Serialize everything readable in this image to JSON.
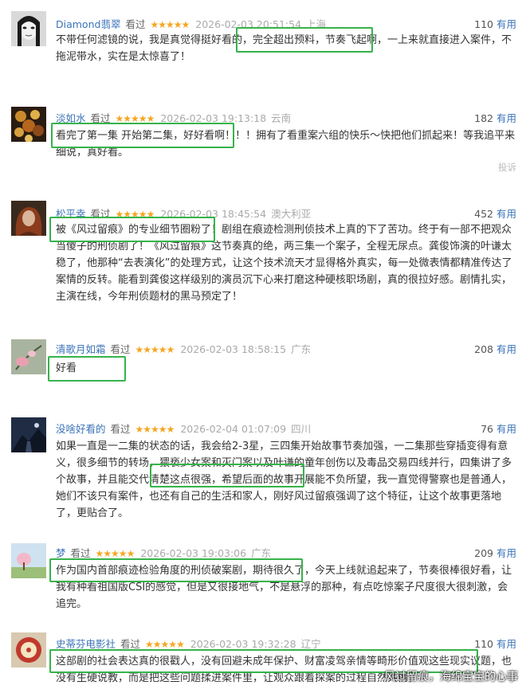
{
  "reviews": [
    {
      "user": "Diamond翡翠",
      "status": "看过",
      "stars": "★★★★★",
      "time": "2026-02-03 20:51:54",
      "location": "上海",
      "useful_count": "110",
      "useful_label": "有用",
      "content": "不带任何滤镜的说，我是真觉得挺好看的，完全超出预料，节奏飞起啊，一上来就直接进入案件，不拖泥带水，实在是太惊喜了！",
      "highlight": "完全超出预料，节奏飞起啊，"
    },
    {
      "user": "淡如水",
      "status": "看过",
      "stars": "★★★★★",
      "time": "2026-02-03 19:13:18",
      "location": "云南",
      "useful_count": "182",
      "useful_label": "有用",
      "content": "看完了第一集 开始第二集，好好看啊！！！拥有了看重案六组的快乐～快把他们抓起来！等我追平来细说，真好看。",
      "highlight": "看完了第一集 开始第二集，好好看啊！",
      "report": "投诉"
    },
    {
      "user": "松平幸",
      "status": "看过",
      "stars": "★★★★★",
      "time": "2026-02-03 18:45:54",
      "location": "澳大利亚",
      "useful_count": "452",
      "useful_label": "有用",
      "content": "被《风过留痕》的专业细节圈粉了！剧组在痕迹检测刑侦技术上真的下了苦功。终于有一部不把观众当傻子的刑侦剧了！《风过留痕》这节奏真的绝，两三集一个案子，全程无尿点。龚俊饰演的叶谦太稳了，他那种“去表演化”的处理方式，让这个技术流天才显得格外真实，每一处微表情都精准传达了案情的反转。能看到龚俊这样级别的演员沉下心来打磨这种硬核职场剧，真的很拉好感。剧情扎实，主演在线，今年刑侦题材的黑马预定了！",
      "highlight": "被《风过留痕》的专业细节圈粉了！"
    },
    {
      "user": "清歌月如霜",
      "status": "看过",
      "stars": "★★★★★",
      "time": "2026-02-03 18:58:15",
      "location": "广东",
      "useful_count": "208",
      "useful_label": "有用",
      "content": "好看",
      "highlight": "好看"
    },
    {
      "user": "没啥好看的",
      "status": "看过",
      "stars": "★★★★★",
      "time": "2026-02-04 01:07:09",
      "location": "四川",
      "useful_count": "76",
      "useful_label": "有用",
      "content": "如果一直是一二集的状态的话，我会给2-3星，三四集开始故事节奏加强，一二集那些穿插变得有意义，很多细节的转场，猥亵少女案和灭门案以及叶谦的童年创伤以及毒品交易四线并行，四集讲了多个故事，并且能交代清楚这点很强，希望后面的故事开展能不负所望，我一直觉得警察也是普通人，她们不该只有案件，也还有自己的生活和家人，刚好风过留痕强调了这个特征，让这个故事更落地了，更贴合了。",
      "highlight": "希望后面的故事开展能不负所望，"
    },
    {
      "user": "梦",
      "status": "看过",
      "stars": "★★★★★",
      "time": "2026-02-03 19:03:06",
      "location": "广东",
      "useful_count": "209",
      "useful_label": "有用",
      "content": "作为国内首部痕迹检验角度的刑侦破案剧，期待很久了，今天上线就追起来了，节奏很棒很好看，让我有种看祖国版CSI的感觉，但是又很接地气，不是悬浮的那种，有点吃惊案子尺度很大很刺激，会追完。",
      "highlight": "作为国内首部痕迹检验角度的刑侦破案剧，期待很久了，"
    },
    {
      "user": "史蒂芬电影社",
      "status": "看过",
      "stars": "★★★★★",
      "time": "2026-02-03 19:32:28",
      "location": "辽宁",
      "useful_count": "110",
      "useful_label": "有用",
      "content": "这部剧的社会表达真的很戳人，没有回避未成年保护、财富凌驾亲情等畸形价值观这些现实议题，也没有生硬说教，而是把这些问题揉进案件里，让观众跟着探案的过程自然共情，",
      "highlight": "这部剧的社会表达真的很戳人，没有回避未成年保护、财富凌驾亲情等畸形价值观这些现实议题，"
    }
  ],
  "watermark": "风过留痕，海绵宝宝的心事"
}
